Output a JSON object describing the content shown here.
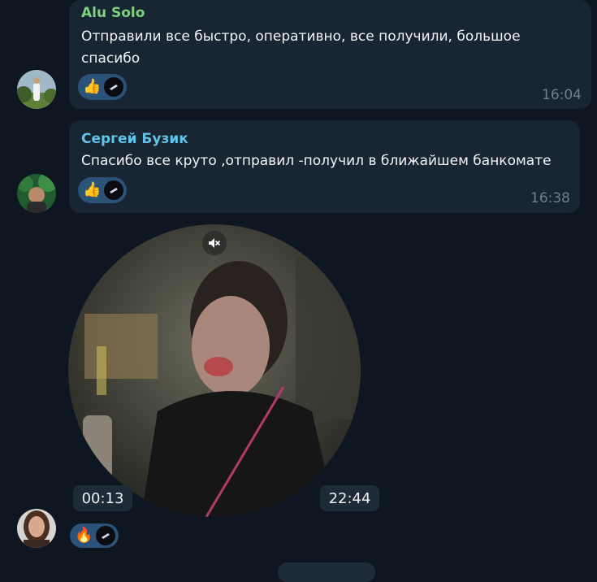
{
  "messages": [
    {
      "sender": "Alu Solo",
      "sender_color": "#7fd17f",
      "text": "Отправили все быстро, оперативно, все получили, большое спасибо",
      "time": "16:04",
      "reactions": [
        {
          "emoji": "👍",
          "icon": "thumbs-up-icon"
        }
      ]
    },
    {
      "sender": "Сергей Бузик",
      "sender_color": "#62c3e8",
      "text": "Спасибо все круто ,отправил -получил в ближайшем банкомате",
      "time": "16:38",
      "reactions": [
        {
          "emoji": "👍",
          "icon": "thumbs-up-icon"
        }
      ]
    }
  ],
  "video_message": {
    "elapsed": "00:13",
    "time": "22:44",
    "reactions": [
      {
        "emoji": "🔥",
        "icon": "fire-icon"
      }
    ]
  },
  "colors": {
    "background": "#0e1621",
    "bubble": "#182533",
    "reaction": "#2b5278"
  }
}
